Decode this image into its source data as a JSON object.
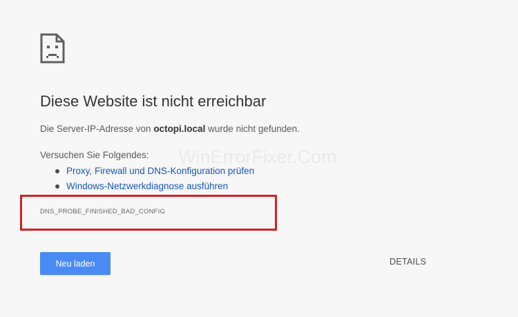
{
  "page": {
    "icon": "sad-page-icon",
    "title": "Diese Website ist nicht erreichbar",
    "summary_prefix": "Die Server-IP-Adresse von ",
    "summary_host": "octopi.local",
    "summary_suffix": " wurde nicht gefunden.",
    "suggestions_heading": "Versuchen Sie Folgendes:",
    "suggestions": [
      {
        "label": "Proxy, Firewall und DNS-Konfiguration prüfen"
      },
      {
        "label": "Windows-Netzwerkdiagnose ausführen"
      }
    ],
    "error_code": "DNS_PROBE_FINISHED_BAD_CONFIG",
    "watermark": "WinErrorFixer.Com",
    "reload_label": "Neu laden",
    "details_label": "DETAILS"
  },
  "colors": {
    "background": "#f7f7f7",
    "link": "#1a56b4",
    "button": "#4a8af4",
    "highlight_box": "#d41f26"
  }
}
